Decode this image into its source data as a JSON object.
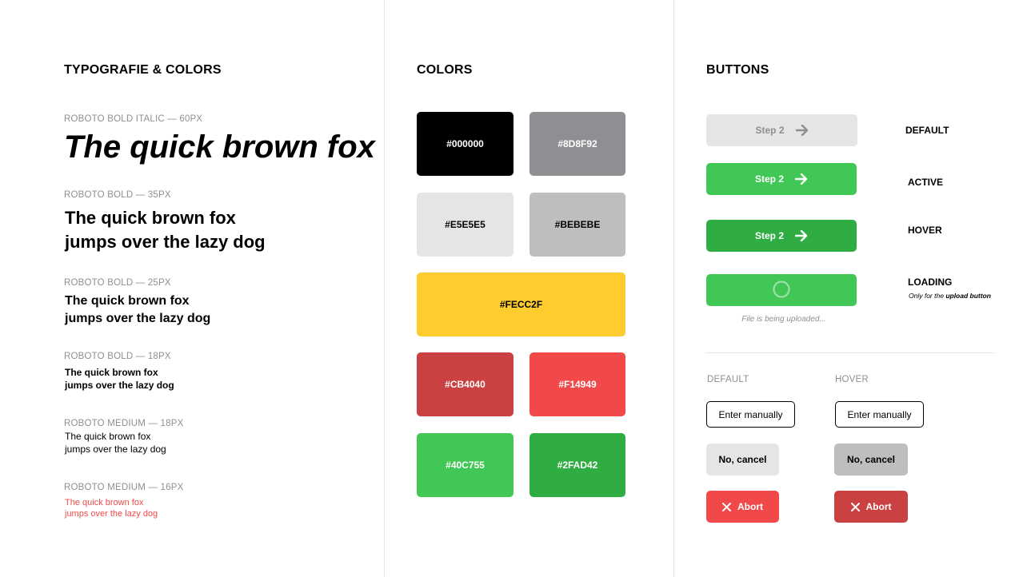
{
  "typography": {
    "title": "TYPOGRAFIE & COLORS",
    "samples": [
      {
        "meta": "ROBOTO BOLD ITALIC — 60PX",
        "line1": "The quick brown fox",
        "line2": ""
      },
      {
        "meta": "ROBOTO BOLD  — 35PX",
        "line1": "The quick brown fox",
        "line2": "jumps over the lazy dog"
      },
      {
        "meta": "ROBOTO BOLD  — 25PX",
        "line1": "The quick brown fox",
        "line2": "jumps over the lazy dog"
      },
      {
        "meta": "ROBOTO BOLD  — 18PX",
        "line1": "The quick brown fox",
        "line2": "jumps over the lazy dog"
      },
      {
        "meta": "ROBOTO MEDIUM  — 18PX",
        "line1": "The quick brown fox",
        "line2": "jumps over the lazy dog"
      },
      {
        "meta": "ROBOTO MEDIUM  — 16PX",
        "line1": "The quick brown fox",
        "line2": "jumps over the lazy dog"
      }
    ]
  },
  "colors": {
    "title": "COLORS",
    "swatches": [
      {
        "label": "#000000",
        "color": "#000000"
      },
      {
        "label": "#8D8F92",
        "color": "#8D8F92"
      },
      {
        "label": "#E5E5E5",
        "color": "#E5E5E5"
      },
      {
        "label": "#BEBEBE",
        "color": "#BEBEBE"
      },
      {
        "label": "#FECC2F",
        "color": "#FECC2F"
      },
      {
        "label": "#CB4040",
        "color": "#CB4040"
      },
      {
        "label": "#F14949",
        "color": "#F14949"
      },
      {
        "label": "#40C755",
        "color": "#40C755"
      },
      {
        "label": "#2FAD42",
        "color": "#2FAD42"
      }
    ]
  },
  "buttons": {
    "title": "BUTTONS",
    "step_label": "Step 2",
    "states": {
      "default": "DEFAULT",
      "active": "ACTIVE",
      "hover": "HOVER",
      "loading": "LOADING",
      "loading_note_prefix": "Only for the ",
      "loading_note_strong": "upload button"
    },
    "uploading_text": "File is being uploaded...",
    "columns": {
      "default": "DEFAULT",
      "hover": "HOVER"
    },
    "enter_manually": "Enter manually",
    "no_cancel": "No, cancel",
    "abort": "Abort"
  }
}
